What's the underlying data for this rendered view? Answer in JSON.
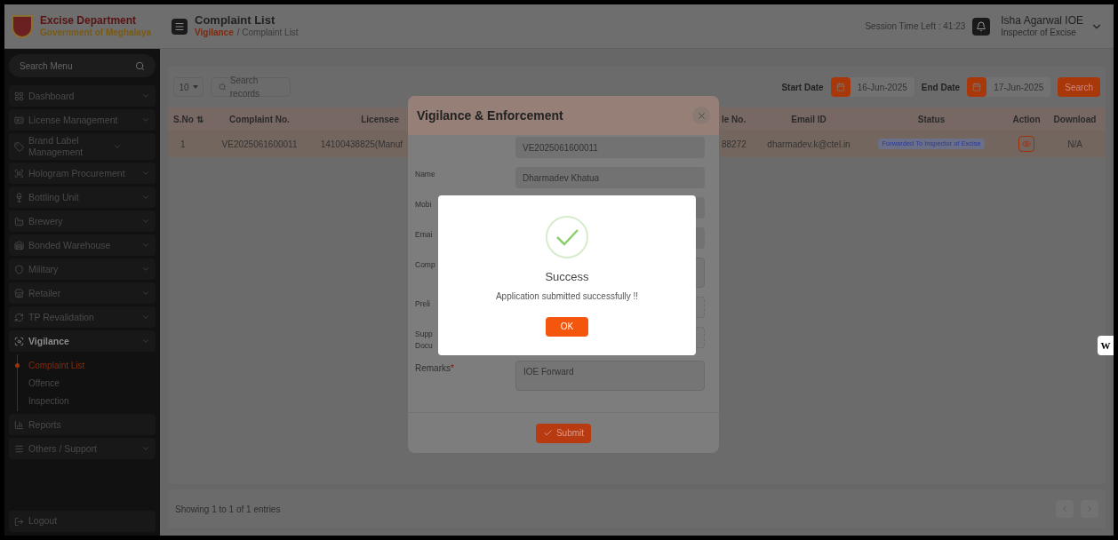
{
  "header": {
    "brand_title": "Excise Department",
    "brand_subtitle": "Government of Meghalaya",
    "page_title": "Complaint List",
    "breadcrumb": [
      {
        "label": "Vigilance",
        "current": false
      },
      {
        "label": "/ Complaint List",
        "current": true
      }
    ],
    "session": "Session Time Left : 41:23",
    "user_name": "Isha Agarwal IOE",
    "user_role": "Inspector of Excise"
  },
  "sidebar": {
    "search_placeholder": "Search Menu",
    "items": [
      {
        "label": "Dashboard",
        "kind": "group",
        "expanded": false
      },
      {
        "label": "License Management",
        "kind": "group",
        "expanded": false
      },
      {
        "label": "Brand Label Management",
        "kind": "group",
        "expanded": false
      },
      {
        "label": "Hologram Procurement",
        "kind": "group",
        "expanded": false
      },
      {
        "label": "Bottling Unit",
        "kind": "group",
        "expanded": false
      },
      {
        "label": "Brewery",
        "kind": "group",
        "expanded": false
      },
      {
        "label": "Bonded Warehouse",
        "kind": "group",
        "expanded": false
      },
      {
        "label": "Military",
        "kind": "group",
        "expanded": false
      },
      {
        "label": "Retailer",
        "kind": "group",
        "expanded": false
      },
      {
        "label": "TP Revalidation",
        "kind": "group",
        "expanded": false
      },
      {
        "label": "Vigilance",
        "kind": "group",
        "expanded": true,
        "children": [
          {
            "label": "Complaint List",
            "selected": true
          },
          {
            "label": "Offence",
            "selected": false
          },
          {
            "label": "Inspection",
            "selected": false
          }
        ]
      },
      {
        "label": "Reports",
        "kind": "link",
        "expanded": false
      },
      {
        "label": "Others / Support",
        "kind": "group",
        "expanded": false
      }
    ],
    "logout": "Logout"
  },
  "toolbar": {
    "page_size": "10",
    "search_placeholder": "Search records",
    "start_label": "Start Date",
    "start_date": "16-Jun-2025",
    "end_label": "End Date",
    "end_date": "17-Jun-2025",
    "search_button": "Search"
  },
  "table": {
    "columns_left": [
      "S.No ⇅",
      "Complaint No.",
      "Licensee"
    ],
    "columns_right": [
      "le No.",
      "Email ID",
      "Status",
      "Action",
      "Download"
    ],
    "rows": [
      {
        "sno": "1",
        "complaint_no": "VE2025061600011",
        "licensee": "14100438825(Manuf",
        "mobile": "88272",
        "email": "dharmadev.k@ctel.in",
        "status": "Forwarded To Inspector of Excise",
        "download": "N/A"
      }
    ]
  },
  "footer": {
    "info": "Showing 1 to 1 of 1 entries"
  },
  "modal": {
    "title": "Vigilance & Enforcement",
    "fields": [
      {
        "kind": "input",
        "value": "VE2025061600011"
      },
      {
        "label": "Name",
        "kind": "input",
        "value": "Dharmadev Khatua"
      },
      {
        "label": "Mobi",
        "kind": "input"
      },
      {
        "label": "Emai",
        "kind": "input"
      },
      {
        "label": "Comp",
        "kind": "textarea"
      },
      {
        "label": "Preli",
        "kind": "file"
      },
      {
        "label": "Supp Docu",
        "kind": "file"
      },
      {
        "label": "Remarks",
        "required_mark": "*",
        "kind": "textarea",
        "value": "IOE Forward"
      }
    ],
    "submit": "Submit"
  },
  "dialog": {
    "title": "Success",
    "message": "Application submitted successfully !!",
    "ok": "OK"
  },
  "side_widget": "W"
}
